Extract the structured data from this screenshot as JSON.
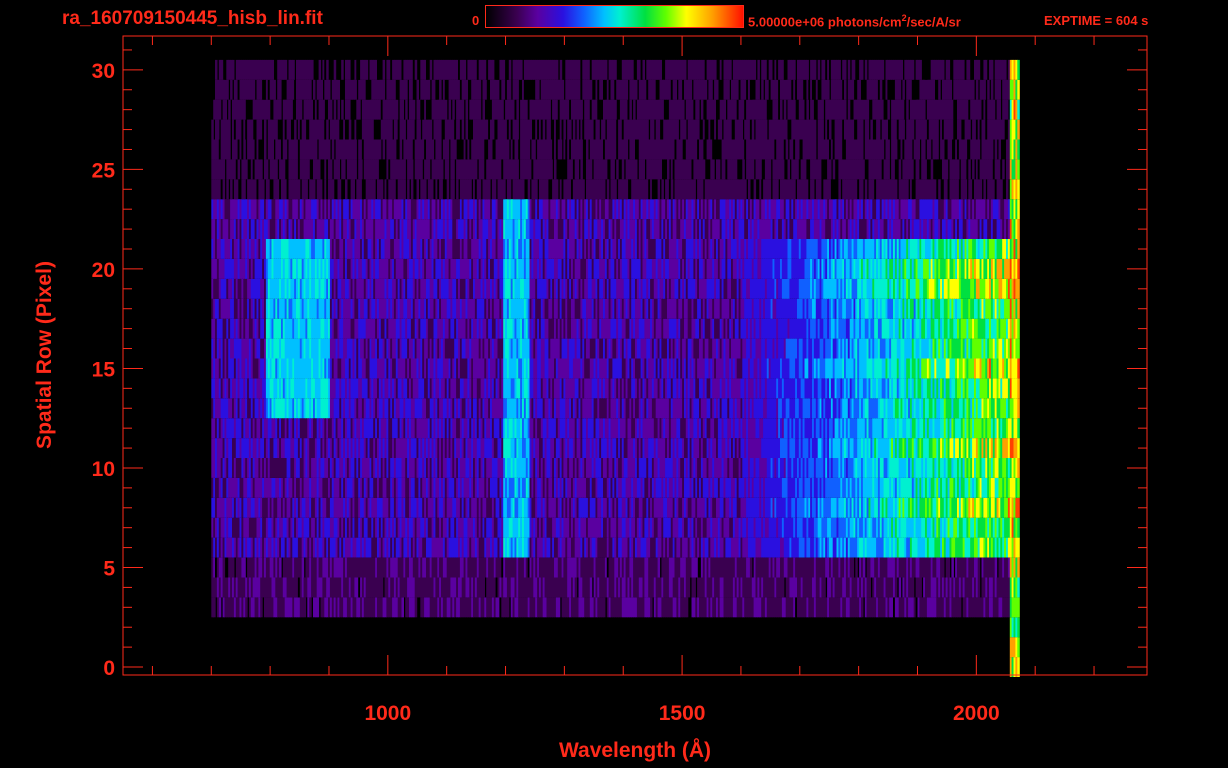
{
  "chart_data": {
    "type": "heatmap",
    "title": "ra_160709150445_hisb_lin.fit",
    "xlabel": "Wavelength (Å)",
    "ylabel": "Spatial Row (Pixel)",
    "xlim": [
      550,
      2290
    ],
    "ylim": [
      -0.4,
      31.7
    ],
    "x_ticks": [
      "1000",
      "1500",
      "2000"
    ],
    "y_ticks": [
      "0",
      "5",
      "10",
      "15",
      "20",
      "25",
      "30"
    ],
    "colorbar": {
      "min_label": "0",
      "max_label_prefix": "5.00000e+06 photons/cm",
      "max_label_exp": "2",
      "max_label_suffix": "/sec/A/sr",
      "colors": [
        "#000000",
        "#3a0050",
        "#5a00a0",
        "#2a10e0",
        "#1060ff",
        "#00c0ff",
        "#00f0d0",
        "#00e040",
        "#60ff00",
        "#ffff00",
        "#ffa000",
        "#ff4000"
      ]
    },
    "exptime": "EXPTIME = 604 s",
    "data_extent": {
      "x": [
        700,
        2070
      ],
      "rows": [
        0,
        30
      ]
    },
    "features": [
      {
        "name": "Lyman-alpha emission line",
        "x": 1216,
        "rows": [
          6,
          23
        ],
        "strength": 0.45
      },
      {
        "name": "extended blob",
        "x": [
          790,
          900
        ],
        "rows": [
          13,
          21
        ],
        "strength": 0.5
      },
      {
        "name": "continuum band",
        "x": [
          1600,
          2060
        ],
        "rows": [
          6,
          21
        ],
        "strength": 0.65
      },
      {
        "name": "detector edge",
        "x": [
          2055,
          2070
        ],
        "rows": [
          0,
          30
        ],
        "strength": 0.9
      }
    ]
  }
}
